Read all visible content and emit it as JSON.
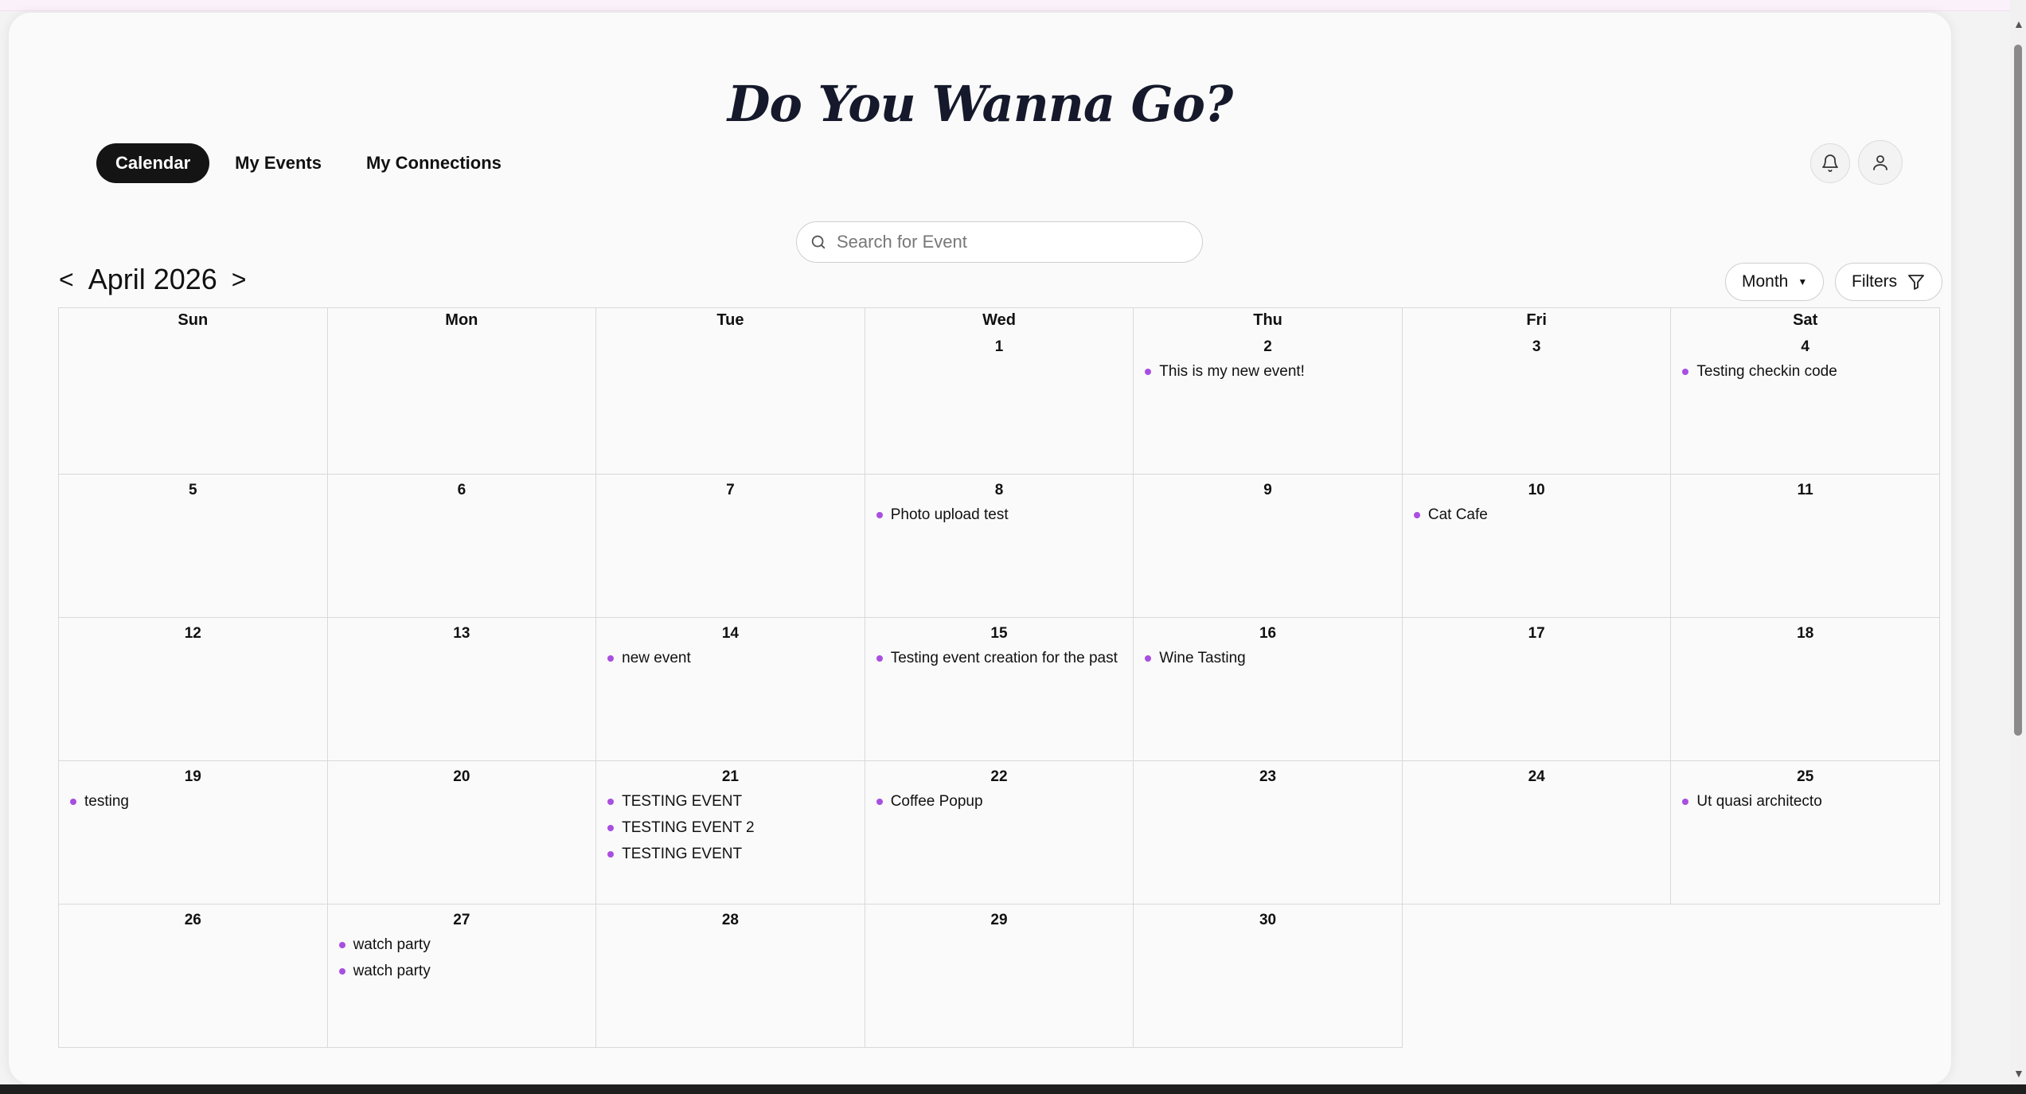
{
  "app": {
    "title": "Do You Wanna Go?"
  },
  "nav": {
    "tabs": [
      {
        "label": "Calendar",
        "active": true
      },
      {
        "label": "My Events",
        "active": false
      },
      {
        "label": "My Connections",
        "active": false
      }
    ]
  },
  "search": {
    "placeholder": "Search for Event"
  },
  "calendar": {
    "month_label": "April 2026",
    "prev_label": "<",
    "next_label": ">",
    "view_label": "Month",
    "filters_label": "Filters",
    "weekdays": [
      "Sun",
      "Mon",
      "Tue",
      "Wed",
      "Thu",
      "Fri",
      "Sat"
    ],
    "weeks": [
      [
        {
          "day": ""
        },
        {
          "day": ""
        },
        {
          "day": ""
        },
        {
          "day": "1",
          "events": []
        },
        {
          "day": "2",
          "events": [
            "This is my new event!"
          ]
        },
        {
          "day": "3",
          "events": []
        },
        {
          "day": "4",
          "events": [
            "Testing checkin code"
          ]
        }
      ],
      [
        {
          "day": "5",
          "events": []
        },
        {
          "day": "6",
          "events": []
        },
        {
          "day": "7",
          "events": []
        },
        {
          "day": "8",
          "events": [
            "Photo upload test"
          ]
        },
        {
          "day": "9",
          "events": []
        },
        {
          "day": "10",
          "events": [
            "Cat Cafe"
          ]
        },
        {
          "day": "11",
          "events": []
        }
      ],
      [
        {
          "day": "12",
          "events": []
        },
        {
          "day": "13",
          "events": []
        },
        {
          "day": "14",
          "events": [
            "new event"
          ]
        },
        {
          "day": "15",
          "events": [
            "Testing event creation for the past"
          ]
        },
        {
          "day": "16",
          "events": [
            "Wine Tasting"
          ]
        },
        {
          "day": "17",
          "events": []
        },
        {
          "day": "18",
          "events": []
        }
      ],
      [
        {
          "day": "19",
          "events": [
            "testing"
          ]
        },
        {
          "day": "20",
          "events": []
        },
        {
          "day": "21",
          "events": [
            "TESTING EVENT",
            "TESTING EVENT 2",
            "TESTING EVENT"
          ]
        },
        {
          "day": "22",
          "events": [
            "Coffee Popup"
          ]
        },
        {
          "day": "23",
          "events": []
        },
        {
          "day": "24",
          "events": []
        },
        {
          "day": "25",
          "events": [
            "Ut quasi architecto"
          ]
        }
      ],
      [
        {
          "day": "26",
          "events": []
        },
        {
          "day": "27",
          "events": [
            "watch party",
            "watch party"
          ]
        },
        {
          "day": "28",
          "events": []
        },
        {
          "day": "29",
          "events": []
        },
        {
          "day": "30",
          "events": []
        },
        {
          "empty": true
        },
        {
          "empty": true
        }
      ]
    ]
  },
  "colors": {
    "accent": "#141414",
    "event_dot": "#a84fe0",
    "title": "#15192b"
  },
  "icons": {
    "notifications": "bell-icon",
    "profile": "user-icon",
    "search": "search-icon",
    "filter": "filter-icon",
    "dropdown": "caret-down-icon"
  }
}
